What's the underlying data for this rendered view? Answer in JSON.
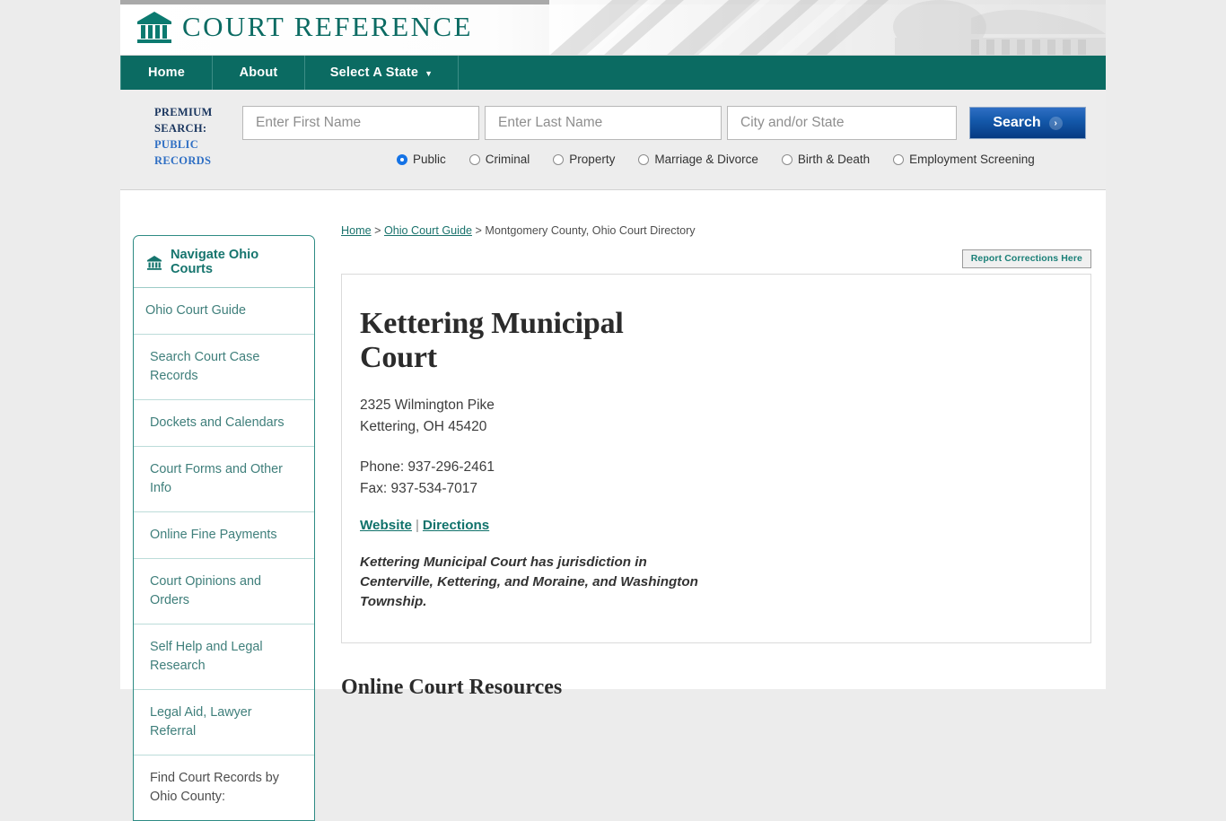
{
  "site": {
    "logo_icon": "courthouse-icon",
    "logo_text": "COURT REFERENCE"
  },
  "nav": {
    "items": [
      {
        "label": "Home",
        "name": "nav-home"
      },
      {
        "label": "About",
        "name": "nav-about"
      },
      {
        "label": "Select A State",
        "name": "nav-select-a-state",
        "caret": "▼"
      }
    ]
  },
  "premium_search": {
    "label_line1": "PREMIUM",
    "label_line2": "SEARCH:",
    "label_line3": "PUBLIC",
    "label_line4": "RECORDS",
    "first_name_placeholder": "Enter First Name",
    "first_name_value": "",
    "last_name_placeholder": "Enter Last Name",
    "last_name_value": "",
    "city_state_placeholder": "City and/or State",
    "city_state_value": "",
    "search_button": "Search",
    "search_chevron": "›",
    "radios": [
      {
        "label": "Public",
        "selected": true
      },
      {
        "label": "Criminal",
        "selected": false
      },
      {
        "label": "Property",
        "selected": false
      },
      {
        "label": "Marriage & Divorce",
        "selected": false
      },
      {
        "label": "Birth & Death",
        "selected": false
      },
      {
        "label": "Employment Screening",
        "selected": false
      }
    ]
  },
  "breadcrumb": {
    "home": "Home",
    "sep1": " > ",
    "guide": "Ohio Court Guide",
    "sep2": " > ",
    "current": "Montgomery County, Ohio Court Directory"
  },
  "report_button": "Report Corrections Here",
  "sidebar": {
    "header": "Navigate Ohio Courts",
    "header_icon": "courthouse-icon",
    "items": [
      {
        "label": "Ohio Court Guide",
        "link": true
      },
      {
        "label": "Search Court Case Records",
        "link": true
      },
      {
        "label": "Dockets and Calendars",
        "link": true
      },
      {
        "label": "Court Forms and Other Info",
        "link": true
      },
      {
        "label": "Online Fine Payments",
        "link": true
      },
      {
        "label": "Court Opinions and Orders",
        "link": true
      },
      {
        "label": "Self Help and Legal Research",
        "link": true
      },
      {
        "label": "Legal Aid, Lawyer Referral",
        "link": true
      },
      {
        "label": "Find Court Records by Ohio County:",
        "link": false
      }
    ]
  },
  "court": {
    "title": "Kettering Municipal Court",
    "address_line1": "2325 Wilmington Pike",
    "address_line2": "Kettering, OH 45420",
    "phone": "Phone: 937-296-2461",
    "fax": "Fax: 937-534-7017",
    "website_label": "Website",
    "link_separator": "|",
    "directions_label": "Directions",
    "jurisdiction": "Kettering Municipal Court has jurisdiction in Centerville, Kettering, and Moraine, and Washington Township."
  },
  "resources": {
    "heading": "Online Court Resources"
  },
  "colors": {
    "teal": "#0b6b62",
    "link_teal": "#10726b",
    "button_blue": "#1459ab",
    "page_bg": "#ececec"
  }
}
